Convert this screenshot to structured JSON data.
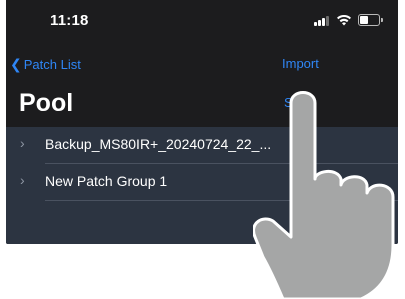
{
  "status_bar": {
    "time": "11:18",
    "signal_icon": "signal-bars-icon",
    "wifi_icon": "wifi-icon",
    "battery_icon": "battery-icon"
  },
  "nav": {
    "back_label": "Patch List",
    "back_icon": "chevron-left-icon",
    "import_label": "Import"
  },
  "title": "Pool",
  "select_label": "S",
  "rows": [
    {
      "label": "Backup_MS80IR+_20240724_22_...",
      "icon": "chevron-right-icon"
    },
    {
      "label": "New Patch Group 1",
      "icon": "chevron-right-icon"
    }
  ],
  "colors": {
    "background": "#1c1c1e",
    "list_background": "#2c3441",
    "accent": "#2f86f6",
    "hand": "#a5a6a6"
  }
}
